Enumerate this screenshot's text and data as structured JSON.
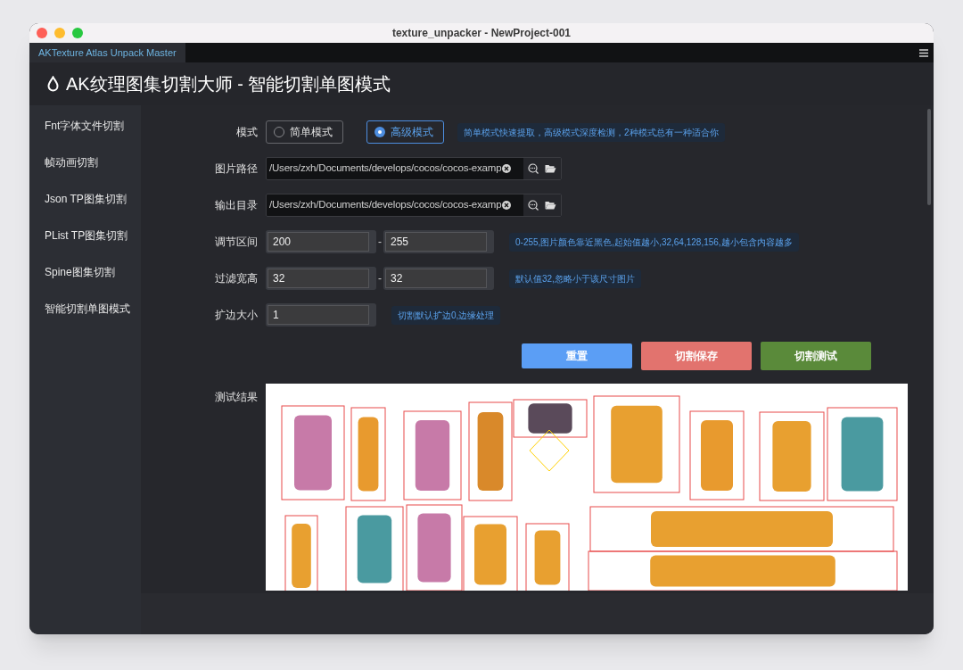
{
  "window": {
    "title": "texture_unpacker - NewProject-001"
  },
  "app_tabs": [
    {
      "label": "AKTexture Atlas Unpack Master",
      "selected": true
    }
  ],
  "header": {
    "title": "AK纹理图集切割大师 - 智能切割单图模式"
  },
  "sidebar": {
    "items": [
      {
        "label": "Fnt字体文件切割"
      },
      {
        "label": "帧动画切割"
      },
      {
        "label": "Json TP图集切割"
      },
      {
        "label": "PList TP图集切割"
      },
      {
        "label": "Spine图集切割"
      },
      {
        "label": "智能切割单图模式"
      }
    ]
  },
  "form": {
    "mode": {
      "label": "模式",
      "options": [
        {
          "label": "简单模式",
          "selected": false
        },
        {
          "label": "高级模式",
          "selected": true
        }
      ],
      "hint": "简单模式快速提取，高级模式深度检测，2种模式总有一种适合你"
    },
    "image_path": {
      "label": "图片路径",
      "value": "/Users/zxh/Documents/develops/cocos/cocos-examp"
    },
    "output_dir": {
      "label": "输出目录",
      "value": "/Users/zxh/Documents/develops/cocos/cocos-examp"
    },
    "range": {
      "label": "调节区间",
      "min": "200",
      "separator": "-",
      "max": "255",
      "hint": "0-255,图片颜色靠近黑色,起始值越小,32,64,128,156,越小包含内容越多"
    },
    "filter_size": {
      "label": "过滤宽高",
      "min": "32",
      "separator": "-",
      "max": "32",
      "hint": "默认值32,忽略小于该尺寸图片"
    },
    "margin": {
      "label": "扩边大小",
      "value": "1",
      "hint": "切割默认扩边0,边缘处理"
    },
    "buttons": [
      {
        "label": "重置",
        "kind": "reset"
      },
      {
        "label": "切割保存",
        "kind": "save"
      },
      {
        "label": "切割测试",
        "kind": "test"
      }
    ],
    "result": {
      "label": "测试结果"
    }
  }
}
